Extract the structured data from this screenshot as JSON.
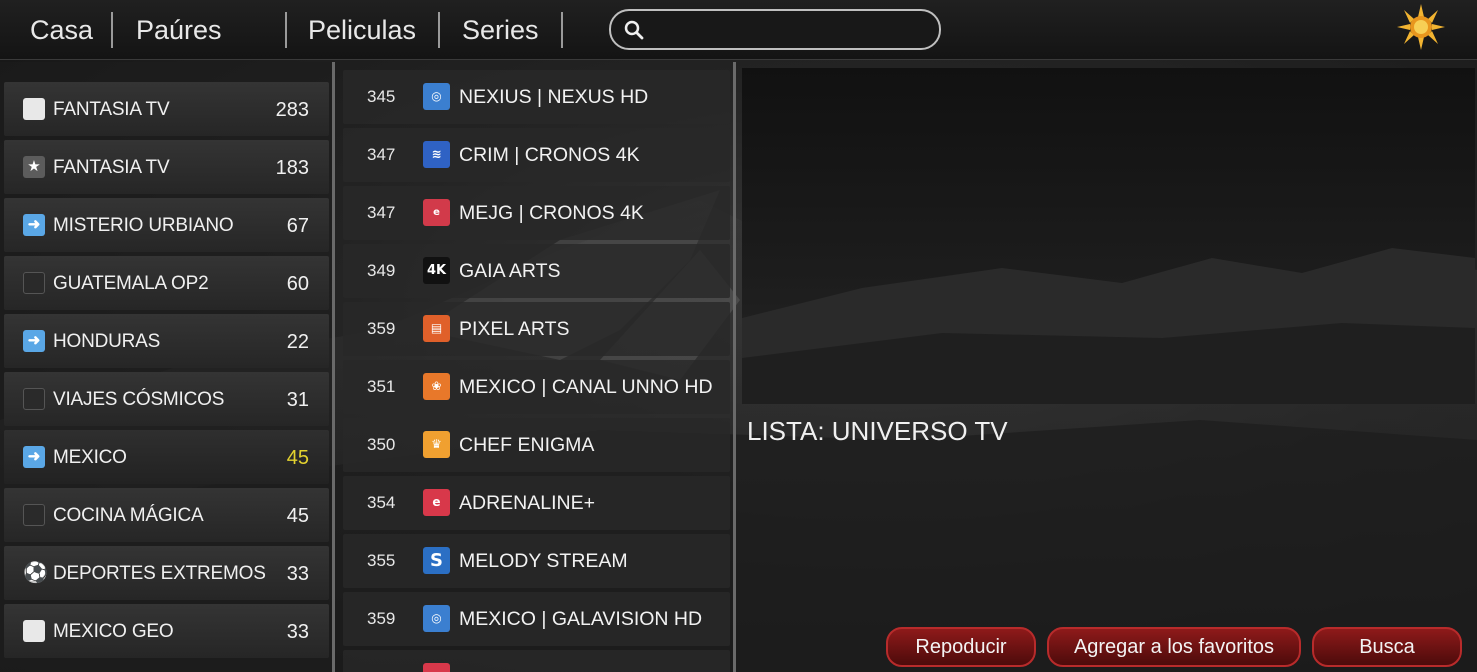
{
  "nav": {
    "items": [
      "Casa",
      "Paúres",
      "Peliculas",
      "Series"
    ],
    "search_placeholder": ""
  },
  "categories": [
    {
      "icon": "white-square-icon",
      "label": "FANTASIA TV",
      "count": "283"
    },
    {
      "icon": "star-icon",
      "label": "FANTASIA TV",
      "count": "183"
    },
    {
      "icon": "arrow-right-icon",
      "label": "MISTERIO URBIANO",
      "count": "67"
    },
    {
      "icon": "black-square-icon",
      "label": "GUATEMALA OP2",
      "count": "60"
    },
    {
      "icon": "arrow-right-icon",
      "label": "HONDURAS",
      "count": "22"
    },
    {
      "icon": "black-square-icon",
      "label": "VIAJES CÓSMICOS",
      "count": "31"
    },
    {
      "icon": "arrow-right-icon",
      "label": "MEXICO",
      "count": "45"
    },
    {
      "icon": "black-square-icon",
      "label": "COCINA MÁGICA",
      "count": "45"
    },
    {
      "icon": "soccer-ball-icon",
      "label": "DEPORTES EXTREMOS",
      "count": "33"
    },
    {
      "icon": "white-square-icon",
      "label": "MEXICO GEO",
      "count": "33"
    }
  ],
  "channels": [
    {
      "number": "345",
      "name": "NEXIUS | NEXUS HD",
      "logo": "circle-logo-icon",
      "logo_color": "#3b7fd0"
    },
    {
      "number": "347",
      "name": "CRIM | CRONOS 4K",
      "logo": "bird-logo-icon",
      "logo_color": "#2f62c4"
    },
    {
      "number": "347",
      "name": "MEJG | CRONOS 4K",
      "logo": "text-logo-icon",
      "logo_color": "#d23a4a"
    },
    {
      "number": "349",
      "name": "GAIA ARTS",
      "logo": "4k-logo-icon",
      "logo_color": "#111111"
    },
    {
      "number": "359",
      "name": "PIXEL ARTS",
      "logo": "orange-logo-icon",
      "logo_color": "#e0602a"
    },
    {
      "number": "351",
      "name": "MEXICO | CANAL UNNO HD",
      "logo": "orange-swirl-logo-icon",
      "logo_color": "#e8782a"
    },
    {
      "number": "350",
      "name": "CHEF ENIGMA",
      "logo": "chef-hat-logo-icon",
      "logo_color": "#f0a030"
    },
    {
      "number": "354",
      "name": "ADRENALINE+",
      "logo": "red-logo-icon",
      "logo_color": "#d8384a"
    },
    {
      "number": "355",
      "name": "MELODY  STREAM",
      "logo": "s-logo-icon",
      "logo_color": "#2b6fc4"
    },
    {
      "number": "359",
      "name": "MEXICO | GALAVISION HD",
      "logo": "circle-logo-icon",
      "logo_color": "#3b7fd0"
    }
  ],
  "info": {
    "lista": "LISTA: UNIVERSO TV"
  },
  "buttons": {
    "play": "Repoducir",
    "favorites": "Agregar a los favoritos",
    "search": "Busca"
  },
  "colors": {
    "accent_red": "#8e1a1a",
    "active_count": "#e3d22f"
  }
}
